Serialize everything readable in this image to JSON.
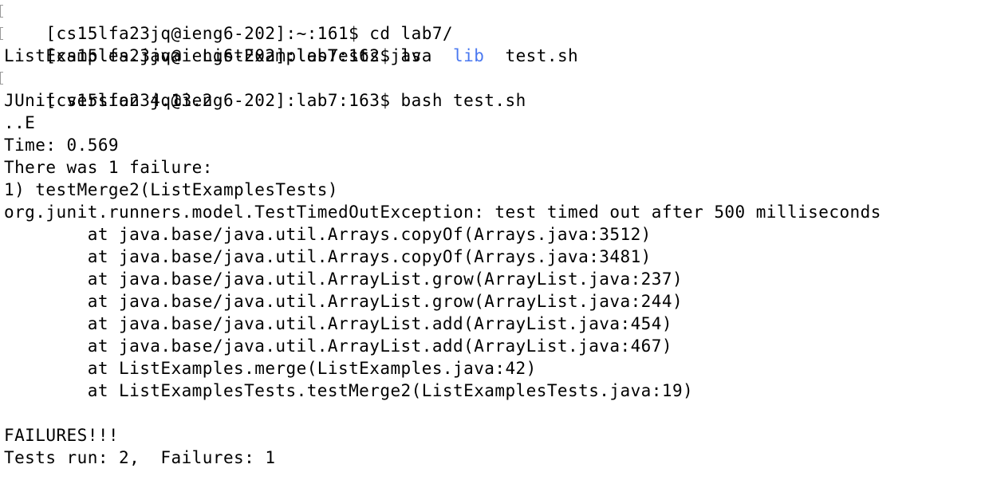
{
  "colors": {
    "background": "#ffffff",
    "text": "#000000",
    "directory": "#4a78f0",
    "prompt_marker": "#9a9a9a"
  },
  "session": {
    "prompts": [
      {
        "prompt": "[cs15lfa23jq@ieng6-202]:~:161$ ",
        "command": "cd lab7/"
      },
      {
        "prompt": "[cs15lfa23jq@ieng6-202]:lab7:162$ ",
        "command": "ls"
      },
      {
        "prompt": "[cs15lfa23jq@ieng6-202]:lab7:163$ ",
        "command": "bash test.sh"
      }
    ],
    "ls_output": [
      {
        "name": "ListExamples.java",
        "type": "file"
      },
      {
        "name": "ListExamplesTests.java",
        "type": "file"
      },
      {
        "name": "lib",
        "type": "directory"
      },
      {
        "name": "test.sh",
        "type": "file"
      }
    ],
    "output": {
      "junit_version": "JUnit version 4.13.2",
      "progress": "..E",
      "time": "Time: 0.569",
      "failure_count": "There was 1 failure:",
      "failure_header": "1) testMerge2(ListExamplesTests)",
      "exception": "org.junit.runners.model.TestTimedOutException: test timed out after 500 milliseconds",
      "stack": [
        "        at java.base/java.util.Arrays.copyOf(Arrays.java:3512)",
        "        at java.base/java.util.Arrays.copyOf(Arrays.java:3481)",
        "        at java.base/java.util.ArrayList.grow(ArrayList.java:237)",
        "        at java.base/java.util.ArrayList.grow(ArrayList.java:244)",
        "        at java.base/java.util.ArrayList.add(ArrayList.java:454)",
        "        at java.base/java.util.ArrayList.add(ArrayList.java:467)",
        "        at ListExamples.merge(ListExamples.java:42)",
        "        at ListExamplesTests.testMerge2(ListExamplesTests.java:19)"
      ],
      "failures_banner": "FAILURES!!!",
      "summary": "Tests run: 2,  Failures: 1"
    }
  }
}
